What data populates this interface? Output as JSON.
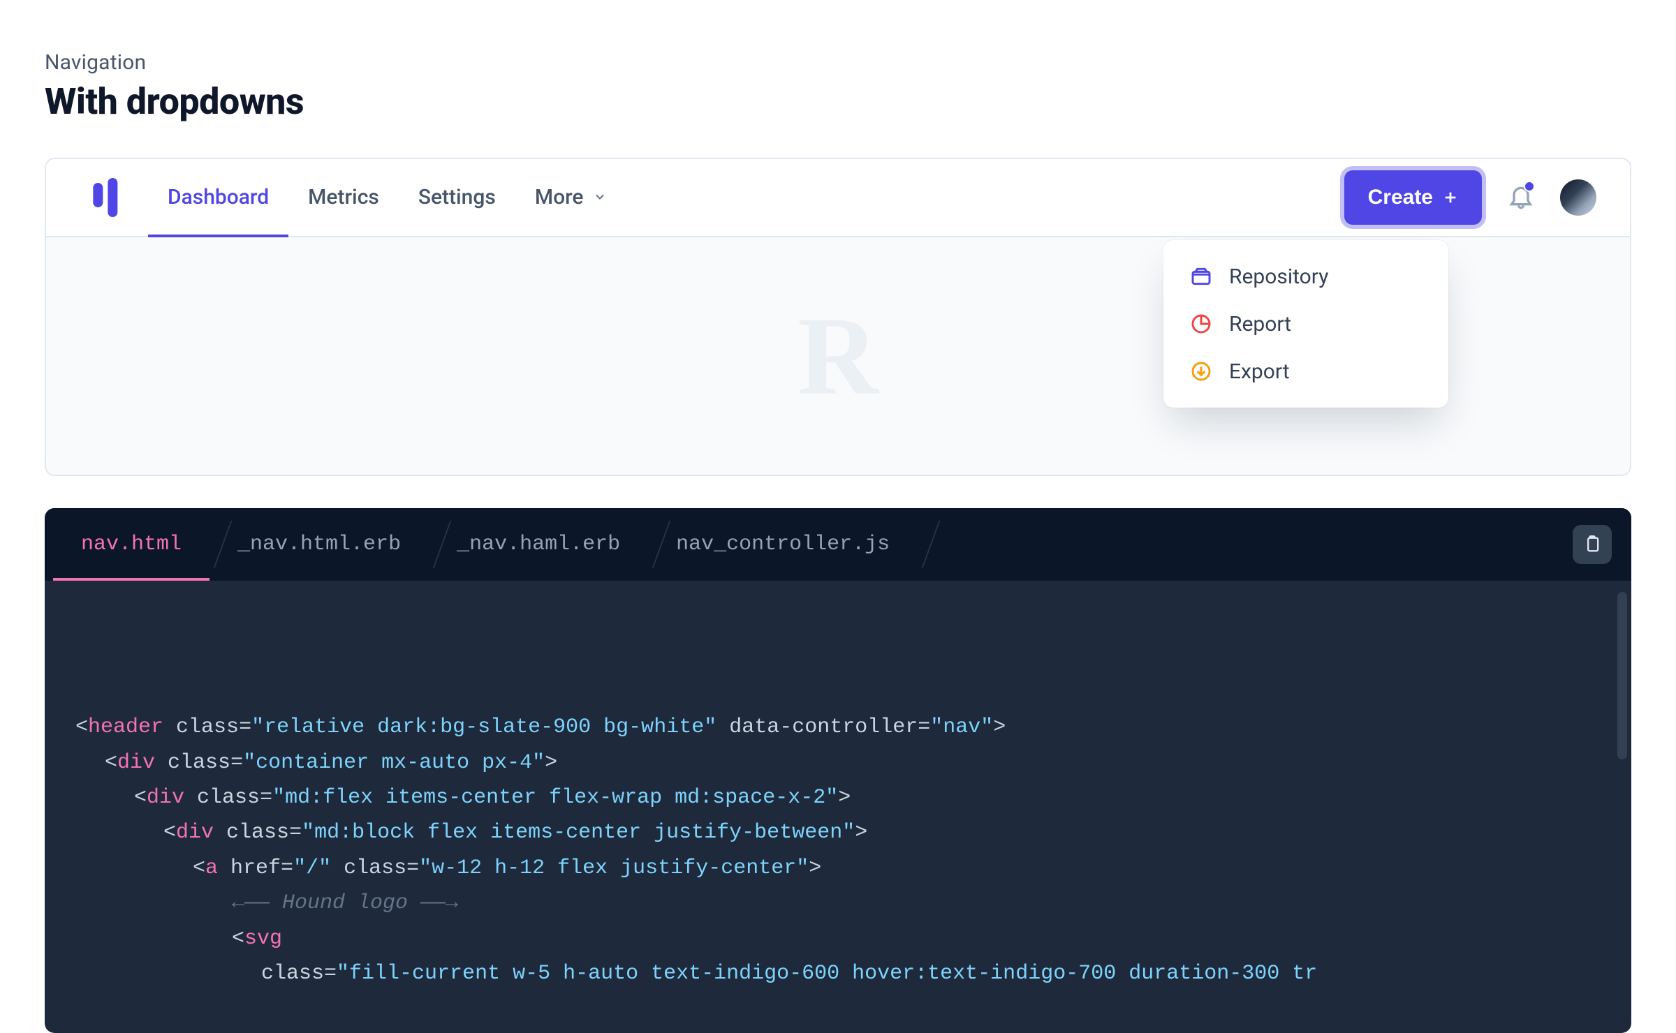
{
  "header": {
    "eyebrow": "Navigation",
    "title": "With dropdowns"
  },
  "nav": {
    "items": [
      {
        "label": "Dashboard",
        "active": true
      },
      {
        "label": "Metrics"
      },
      {
        "label": "Settings"
      },
      {
        "label": "More",
        "hasDropdown": true
      }
    ],
    "create_label": "Create",
    "watermark": "R"
  },
  "createDropdown": {
    "items": [
      {
        "label": "Repository",
        "icon": "box",
        "color": "#4f46e5"
      },
      {
        "label": "Report",
        "icon": "pie",
        "color": "#ef4444"
      },
      {
        "label": "Export",
        "icon": "download-circle",
        "color": "#f59e0b"
      }
    ]
  },
  "code": {
    "tabs": [
      {
        "label": "nav.html",
        "active": true
      },
      {
        "label": "_nav.html.erb"
      },
      {
        "label": "_nav.haml.erb"
      },
      {
        "label": "nav_controller.js"
      }
    ],
    "lines": [
      {
        "indent": 1,
        "tokens": [
          {
            "t": "punct",
            "v": "<"
          },
          {
            "t": "tag",
            "v": "header"
          },
          {
            "t": "attr",
            "v": " class"
          },
          {
            "t": "eq",
            "v": "="
          },
          {
            "t": "str",
            "v": "\"relative dark:bg-slate-900 bg-white\""
          },
          {
            "t": "attr",
            "v": " data-controller"
          },
          {
            "t": "eq",
            "v": "="
          },
          {
            "t": "str",
            "v": "\"nav\""
          },
          {
            "t": "punct",
            "v": ">"
          }
        ]
      },
      {
        "indent": 2,
        "tokens": [
          {
            "t": "punct",
            "v": "<"
          },
          {
            "t": "tag",
            "v": "div"
          },
          {
            "t": "attr",
            "v": " class"
          },
          {
            "t": "eq",
            "v": "="
          },
          {
            "t": "str",
            "v": "\"container mx-auto px-4\""
          },
          {
            "t": "punct",
            "v": ">"
          }
        ]
      },
      {
        "indent": 3,
        "tokens": [
          {
            "t": "punct",
            "v": "<"
          },
          {
            "t": "tag",
            "v": "div"
          },
          {
            "t": "attr",
            "v": " class"
          },
          {
            "t": "eq",
            "v": "="
          },
          {
            "t": "str",
            "v": "\"md:flex items-center flex-wrap md:space-x-2\""
          },
          {
            "t": "punct",
            "v": ">"
          }
        ]
      },
      {
        "indent": 4,
        "tokens": [
          {
            "t": "punct",
            "v": "<"
          },
          {
            "t": "tag",
            "v": "div"
          },
          {
            "t": "attr",
            "v": " class"
          },
          {
            "t": "eq",
            "v": "="
          },
          {
            "t": "str",
            "v": "\"md:block flex items-center justify-between\""
          },
          {
            "t": "punct",
            "v": ">"
          }
        ]
      },
      {
        "indent": 5,
        "tokens": [
          {
            "t": "punct",
            "v": "<"
          },
          {
            "t": "tag",
            "v": "a"
          },
          {
            "t": "attr",
            "v": " href"
          },
          {
            "t": "eq",
            "v": "="
          },
          {
            "t": "str",
            "v": "\"/\""
          },
          {
            "t": "attr",
            "v": " class"
          },
          {
            "t": "eq",
            "v": "="
          },
          {
            "t": "str",
            "v": "\"w-12 h-12 flex justify-center\""
          },
          {
            "t": "punct",
            "v": ">"
          }
        ]
      },
      {
        "indent": 6,
        "tokens": [
          {
            "t": "comment",
            "v": "←—— Hound logo ——→"
          }
        ]
      },
      {
        "indent": 6,
        "tokens": [
          {
            "t": "punct",
            "v": "<"
          },
          {
            "t": "tag",
            "v": "svg"
          }
        ]
      },
      {
        "indent": 8,
        "tokens": [
          {
            "t": "attr",
            "v": "class"
          },
          {
            "t": "eq",
            "v": "="
          },
          {
            "t": "str",
            "v": "\"fill-current w-5 h-auto text-indigo-600 hover:text-indigo-700 duration-300 tr"
          }
        ]
      }
    ]
  }
}
